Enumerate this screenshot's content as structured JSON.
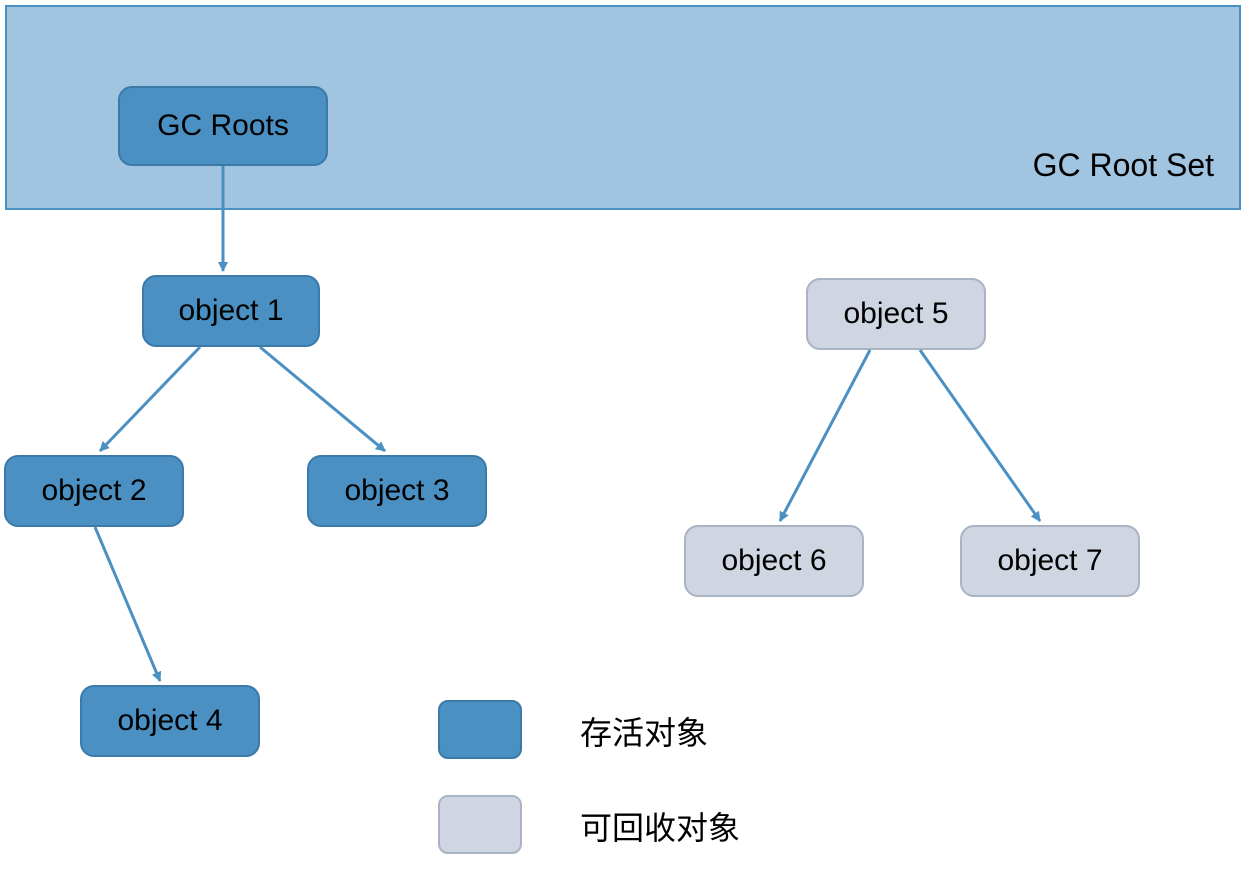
{
  "rootSet": {
    "label": "GC Root Set"
  },
  "nodes": {
    "gcRoots": {
      "label": "GC Roots"
    },
    "obj1": {
      "label": "object 1"
    },
    "obj2": {
      "label": "object 2"
    },
    "obj3": {
      "label": "object 3"
    },
    "obj4": {
      "label": "object 4"
    },
    "obj5": {
      "label": "object 5"
    },
    "obj6": {
      "label": "object 6"
    },
    "obj7": {
      "label": "object 7"
    }
  },
  "legend": {
    "alive": "存活对象",
    "collectible": "可回收对象"
  },
  "colors": {
    "alive": "#4a90c2",
    "collectible": "#cfd6e2",
    "rootSetBg": "#a1c4e0",
    "arrow": "#4a90c2"
  },
  "chart_data": {
    "type": "diagram",
    "title": "GC Root Set reachability",
    "nodes": [
      {
        "id": "gcRoots",
        "label": "GC Roots",
        "status": "alive",
        "inRootSet": true
      },
      {
        "id": "obj1",
        "label": "object 1",
        "status": "alive"
      },
      {
        "id": "obj2",
        "label": "object 2",
        "status": "alive"
      },
      {
        "id": "obj3",
        "label": "object 3",
        "status": "alive"
      },
      {
        "id": "obj4",
        "label": "object 4",
        "status": "alive"
      },
      {
        "id": "obj5",
        "label": "object 5",
        "status": "collectible"
      },
      {
        "id": "obj6",
        "label": "object 6",
        "status": "collectible"
      },
      {
        "id": "obj7",
        "label": "object 7",
        "status": "collectible"
      }
    ],
    "edges": [
      {
        "from": "gcRoots",
        "to": "obj1"
      },
      {
        "from": "obj1",
        "to": "obj2"
      },
      {
        "from": "obj1",
        "to": "obj3"
      },
      {
        "from": "obj2",
        "to": "obj4"
      },
      {
        "from": "obj5",
        "to": "obj6"
      },
      {
        "from": "obj5",
        "to": "obj7"
      }
    ],
    "legend": {
      "alive": "存活对象",
      "collectible": "可回收对象"
    }
  }
}
